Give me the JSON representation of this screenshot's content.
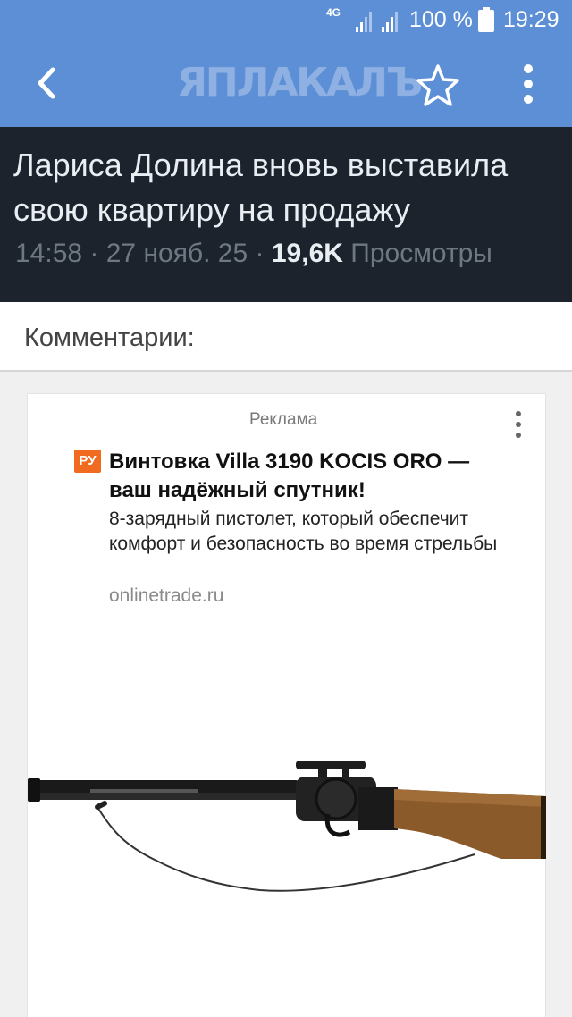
{
  "status_bar": {
    "network": "4G",
    "battery_percent": "100 %",
    "time": "19:29"
  },
  "app_bar": {
    "logo": "ЯПЛАКАЛЪ",
    "icons": [
      "back-arrow-icon",
      "star-icon",
      "more-vertical-icon"
    ]
  },
  "article": {
    "title": "Лариса Долина вновь выставила свою квартиру на продажу",
    "time": "14:58",
    "date": "27 нояб. 25",
    "views": "19,6K",
    "views_label": "Просмотры"
  },
  "comments": {
    "header": "Комментарии:"
  },
  "ad": {
    "label": "Реклама",
    "badge": "РУ",
    "headline": "Винтовка Villa 3190 KOCIS ORO — ваш надёжный спутник!",
    "description": "8-зарядный пистолет, который обеспечит комфорт и безопасность во время стрельбы",
    "domain": "onlinetrade.ru"
  },
  "colors": {
    "header_blue": "#5c8fd6",
    "title_bg": "#1c232c",
    "badge_orange": "#f06a1f"
  }
}
